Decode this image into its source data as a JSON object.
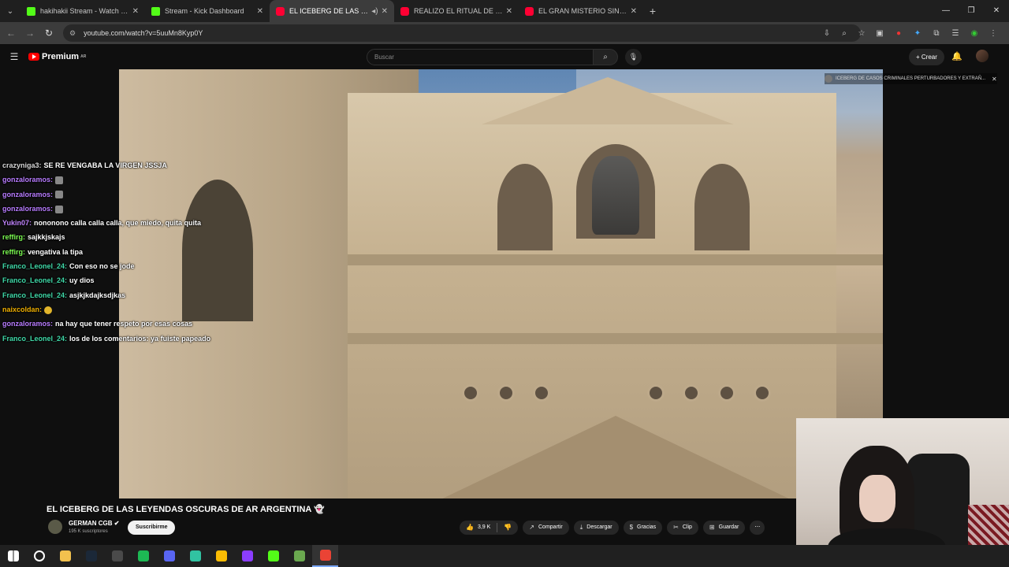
{
  "browser": {
    "tabs": [
      {
        "label": "hakihakii Stream - Watch Live o",
        "favicon_color": "#53fc18",
        "active": false
      },
      {
        "label": "Stream - Kick Dashboard",
        "favicon_color": "#53fc18",
        "active": false
      },
      {
        "label": "EL ICEBERG DE LAS LEYEND",
        "favicon_color": "#ff0033",
        "active": true
      },
      {
        "label": "REALIZO EL RITUAL DE HITORI",
        "favicon_color": "#ff0033",
        "active": false
      },
      {
        "label": "EL GRAN MISTERIO SIN RESOLV",
        "favicon_color": "#ff0033",
        "active": false
      }
    ],
    "url": "youtube.com/watch?v=5uuMn8Kyp0Y"
  },
  "youtube": {
    "logo_text": "Premium",
    "region": "AR",
    "search_placeholder": "Buscar",
    "create_label": "Crear",
    "overlay_title": "ICEBERG DE CASOS CRIMINALES PERTURBADORES Y EXTRAÑ..."
  },
  "chat": [
    {
      "user": "crazyniga3:",
      "color": "#d6d6d6",
      "text": "SE RE VENGABA LA VIRGEN JSSJA"
    },
    {
      "user": "gonzaloramos:",
      "color": "#b87cff",
      "text": "",
      "emote": true
    },
    {
      "user": "gonzaloramos:",
      "color": "#b87cff",
      "text": "",
      "emote": true
    },
    {
      "user": "gonzaloramos:",
      "color": "#b87cff",
      "text": "",
      "emote": true
    },
    {
      "user": "Yukin07:",
      "color": "#c084fc",
      "text": "nononono calla calla calla, que miedo, quita quita"
    },
    {
      "user": "reffirg:",
      "color": "#7cfc52",
      "text": "sajkkjskajs"
    },
    {
      "user": "reffirg:",
      "color": "#7cfc52",
      "text": "vengativa la tipa"
    },
    {
      "user": "Franco_Leonel_24:",
      "color": "#3fd9a8",
      "text": "Con eso no se jode"
    },
    {
      "user": "Franco_Leonel_24:",
      "color": "#3fd9a8",
      "text": "uy dios"
    },
    {
      "user": "Franco_Leonel_24:",
      "color": "#3fd9a8",
      "text": "asjkjkdajksdjkas"
    },
    {
      "user": "naixcoldan:",
      "color": "#f0b000",
      "text": "",
      "emote": true
    },
    {
      "user": "gonzaloramos:",
      "color": "#b87cff",
      "text": "na hay que tener respeto por esas cosas"
    },
    {
      "user": "Franco_Leonel_24:",
      "color": "#3fd9a8",
      "text": "los de los comentarios: ya fuiste papeado"
    }
  ],
  "video": {
    "title": "EL ICEBERG DE LAS LEYENDAS OSCURAS DE AR ARGENTINA",
    "channel": "GERMAN CGB",
    "subscribers": "195 K suscriptores",
    "subscribe_label": "Suscribirme",
    "likes": "3,9 K",
    "share_label": "Compartir",
    "download_label": "Descargar",
    "thanks_label": "Gracias",
    "clip_label": "Clip",
    "save_label": "Guardar"
  },
  "taskbar_icons": [
    "windows-start-icon",
    "search-icon",
    "file-explorer-icon",
    "steam-icon",
    "obs-icon",
    "spotify-icon",
    "discord-icon",
    "streamlabs-icon",
    "chrome-icon",
    "canva-icon",
    "kick-icon",
    "minecraft-icon",
    "chrome-active-icon"
  ]
}
